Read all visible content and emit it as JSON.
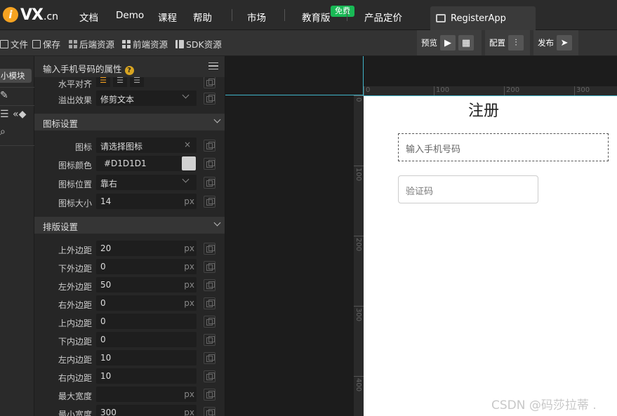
{
  "topbar": {
    "logo_main": "VX",
    "logo_suffix": ".cn",
    "nav": [
      "文档",
      "Demo",
      "课程",
      "帮助",
      "市场",
      "教育版",
      "产品定价"
    ],
    "badge": "免费",
    "app_tab": "RegisterApp"
  },
  "toolbar": {
    "items": [
      "文件",
      "保存",
      "后端资源",
      "前端资源",
      "SDK资源"
    ],
    "preview": "预览",
    "config": "配置",
    "publish": "发布"
  },
  "rail": {
    "chip": "小模块"
  },
  "panel": {
    "title": "输入手机号码的属性",
    "help": "?",
    "rows_top": [
      {
        "label": "水平对齐"
      },
      {
        "label": "溢出效果",
        "value": "修剪文本"
      }
    ],
    "section_icon": "图标设置",
    "icon_rows": [
      {
        "label": "图标",
        "value": "请选择图标"
      },
      {
        "label": "图标颜色",
        "value": "#D1D1D1",
        "swatch": "#D1D1D1"
      },
      {
        "label": "图标位置",
        "value": "靠右"
      },
      {
        "label": "图标大小",
        "value": "14",
        "unit": "px"
      }
    ],
    "section_layout": "排版设置",
    "layout_rows": [
      {
        "label": "上外边距",
        "value": "20",
        "unit": "px"
      },
      {
        "label": "下外边距",
        "value": "0",
        "unit": "px"
      },
      {
        "label": "左外边距",
        "value": "50",
        "unit": "px"
      },
      {
        "label": "右外边距",
        "value": "0",
        "unit": "px"
      },
      {
        "label": "上内边距",
        "value": "0",
        "unit": ""
      },
      {
        "label": "下内边距",
        "value": "0",
        "unit": ""
      },
      {
        "label": "左内边距",
        "value": "10",
        "unit": ""
      },
      {
        "label": "右内边距",
        "value": "10",
        "unit": ""
      },
      {
        "label": "最大宽度",
        "value": "",
        "unit": "px"
      },
      {
        "label": "最小宽度",
        "value": "300",
        "unit": "px"
      }
    ]
  },
  "canvas": {
    "ruler_top": [
      "0",
      "100",
      "200",
      "300"
    ],
    "ruler_left": [
      "0",
      "100",
      "200",
      "300",
      "400"
    ],
    "page_title": "注册",
    "phone_placeholder": "输入手机号码",
    "code_placeholder": "验证码"
  },
  "watermark": "CSDN @码莎拉蒂 ."
}
